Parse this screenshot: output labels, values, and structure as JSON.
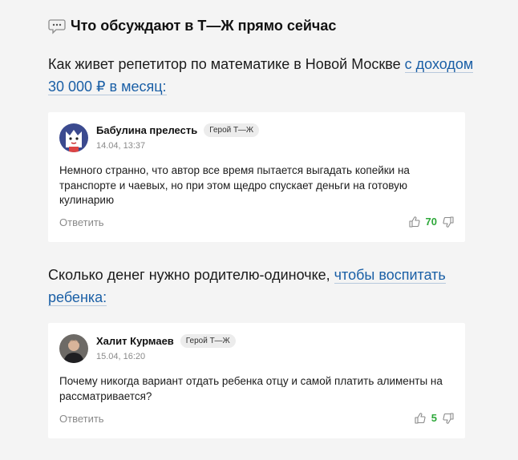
{
  "header": {
    "title": "Что обсуждают в Т—Ж прямо сейчас",
    "icon": "speech-bubble-icon"
  },
  "discussions": [
    {
      "intro_text": "Как живет репетитор по математике в Новой Москве ",
      "link_text": "с доходом 30 000 ₽ в месяц:",
      "comment": {
        "author": "Бабулина прелесть",
        "badge": "Герой Т—Ж",
        "date": "14.04, 13:37",
        "text": "Немного странно, что автор все время пытается выгадать копейки на транспорте и чаевых, но при этом щедро спускает деньги на готовую кулинарию",
        "reply_label": "Ответить",
        "likes": "70",
        "avatar_icon": "cat-avatar-icon"
      }
    },
    {
      "intro_text": "Сколько денег нужно родителю-одиночке, ",
      "link_text": "чтобы воспитать ребенка:",
      "comment": {
        "author": "Халит Курмаев",
        "badge": "Герой Т—Ж",
        "date": "15.04, 16:20",
        "text": "Почему никогда вариант отдать ребенка отцу и самой платить алименты на рассматривается?",
        "reply_label": "Ответить",
        "likes": "5",
        "avatar_icon": "user-photo-avatar-icon"
      }
    }
  ],
  "colors": {
    "background": "#f4f4f4",
    "link": "#1a5fa6",
    "likes": "#2ea83a",
    "muted": "#8a8a8a"
  }
}
